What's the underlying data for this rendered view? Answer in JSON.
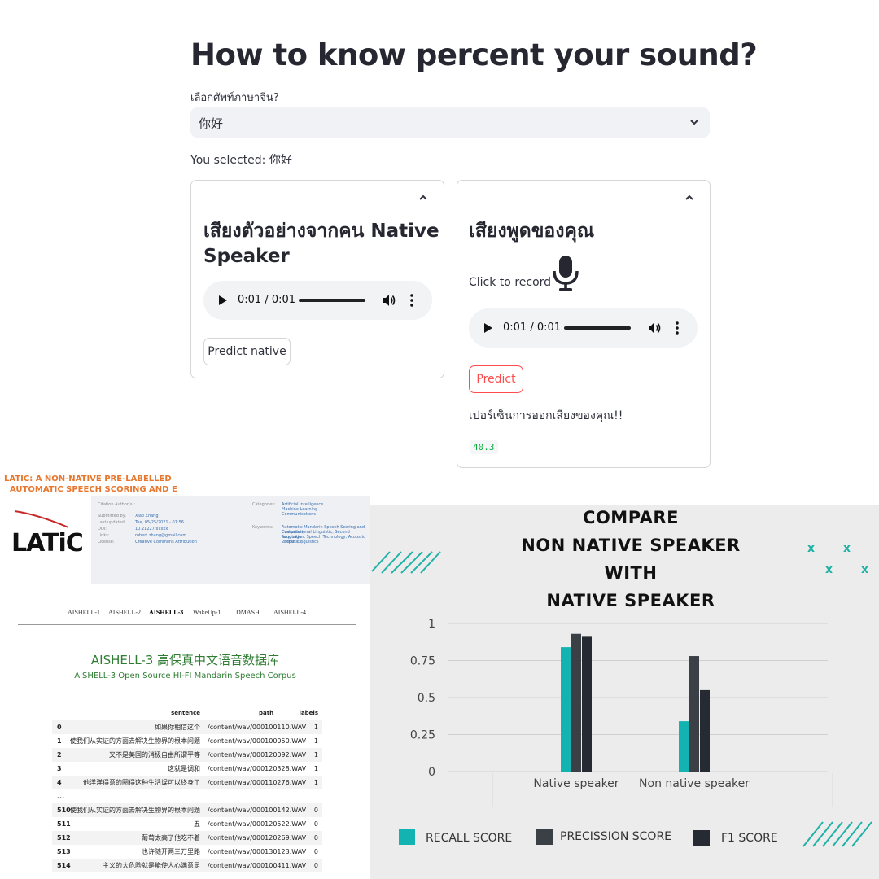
{
  "app": {
    "title": "How to know percent your sound?",
    "select_label": "เลือกศัพท์ภาษาจีน?",
    "select_value": "你好",
    "selected_text": "You selected: 你好"
  },
  "native_card": {
    "heading_line1": "เสียงตัวอย่างจากคน Native",
    "heading_line2": "Speaker",
    "audio_time": "0:01 / 0:01",
    "button": "Predict native"
  },
  "user_card": {
    "heading": "เสียงพูดของคุณ",
    "record_label": "Click to record",
    "audio_time": "0:01 / 0:01",
    "button": "Predict",
    "percent_label": "เปอร์เซ็นการออกเสียงของคุณ!!",
    "percent_value": "40.3"
  },
  "latic": {
    "banner_line1": "LATIC: A NON-NATIVE PRE-LABELLED",
    "banner_line2": "AUTOMATIC SPEECH SCORING AND E",
    "logo": "LATiC",
    "meta_keys": [
      "Citation Author(s):",
      "Submitted by:",
      "Last updated:",
      "DOI:",
      "Links:",
      "License:"
    ],
    "meta_values": [
      "Xiao Zhang",
      "Tue, 05/25/2021 - 07:56",
      "10.21227/xxxxx",
      "robert.zhang@gmail.com",
      "Creative Commons Attribution"
    ],
    "cat_key": "Categories:",
    "cat_values": [
      "Artificial Intelligence",
      "Machine Learning",
      "Communications"
    ],
    "kw_key": "Keywords:",
    "kw_values": [
      "Automatic Mandarin Speech Scoring and Evaluation,",
      "Computational Linguistic, Second Language",
      "Acquisition, Speech Technology, Acoustic Phonetics,",
      "Corpus Linguistics"
    ]
  },
  "aishell": {
    "tabs": [
      "AISHELL-1",
      "AISHELL-2",
      "AISHELL-3",
      "WakeUp-1",
      "DMASH",
      "AISHELL-4"
    ],
    "active_tab": "AISHELL-3",
    "title": "AISHELL-3 高保真中文语音数据库",
    "subtitle": "AISHELL-3 Open Source HI-FI Mandarin Speech Corpus",
    "columns": [
      "sentence",
      "path",
      "labels"
    ],
    "rows": [
      {
        "idx": "0",
        "sentence": "如果你相信这个",
        "path": "/content/wav/000100110.WAV",
        "label": "1"
      },
      {
        "idx": "1",
        "sentence": "使我们从实证的方面去解决生物界的根本问题",
        "path": "/content/wav/000100050.WAV",
        "label": "1"
      },
      {
        "idx": "2",
        "sentence": "又不是美国的消极自由所谓平等",
        "path": "/content/wav/000120092.WAV",
        "label": "1"
      },
      {
        "idx": "3",
        "sentence": "这就是调和",
        "path": "/content/wav/000120328.WAV",
        "label": "1"
      },
      {
        "idx": "4",
        "sentence": "他洋洋得意的圈得这种生活误可以终身了",
        "path": "/content/wav/000110276.WAV",
        "label": "1"
      },
      {
        "idx": "...",
        "sentence": "...",
        "path": "...",
        "label": "..."
      },
      {
        "idx": "510",
        "sentence": "使我们从实证的方面去解决生物界的根本问题",
        "path": "/content/wav/000100142.WAV",
        "label": "0"
      },
      {
        "idx": "511",
        "sentence": "五",
        "path": "/content/wav/000120522.WAV",
        "label": "0"
      },
      {
        "idx": "512",
        "sentence": "葡萄太高了他吃不着",
        "path": "/content/wav/000120269.WAV",
        "label": "0"
      },
      {
        "idx": "513",
        "sentence": "也许随开两三万里路",
        "path": "/content/wav/000130123.WAV",
        "label": "0"
      },
      {
        "idx": "514",
        "sentence": "主义的大危险就是能使人心满意足",
        "path": "/content/wav/000100411.WAV",
        "label": "0"
      }
    ]
  },
  "chart_data": {
    "type": "bar",
    "title_lines": [
      "COMPARE",
      "NON NATIVE SPEAKER",
      "WITH",
      "NATIVE SPEAKER"
    ],
    "categories": [
      "Native speaker",
      "Non native speaker"
    ],
    "series": [
      {
        "name": "RECALL SCORE",
        "values": [
          0.84,
          0.34
        ],
        "color": "#12b3b0"
      },
      {
        "name": "PRECISSION SCORE",
        "values": [
          0.93,
          0.78
        ],
        "color": "#3b4047"
      },
      {
        "name": "F1 SCORE",
        "values": [
          0.91,
          0.55
        ],
        "color": "#252a33"
      }
    ],
    "yticks": [
      "0",
      "0.25",
      "0.5",
      "0.75",
      "1"
    ],
    "ylim": [
      0,
      1
    ],
    "grid": true,
    "legend_position": "bottom"
  }
}
